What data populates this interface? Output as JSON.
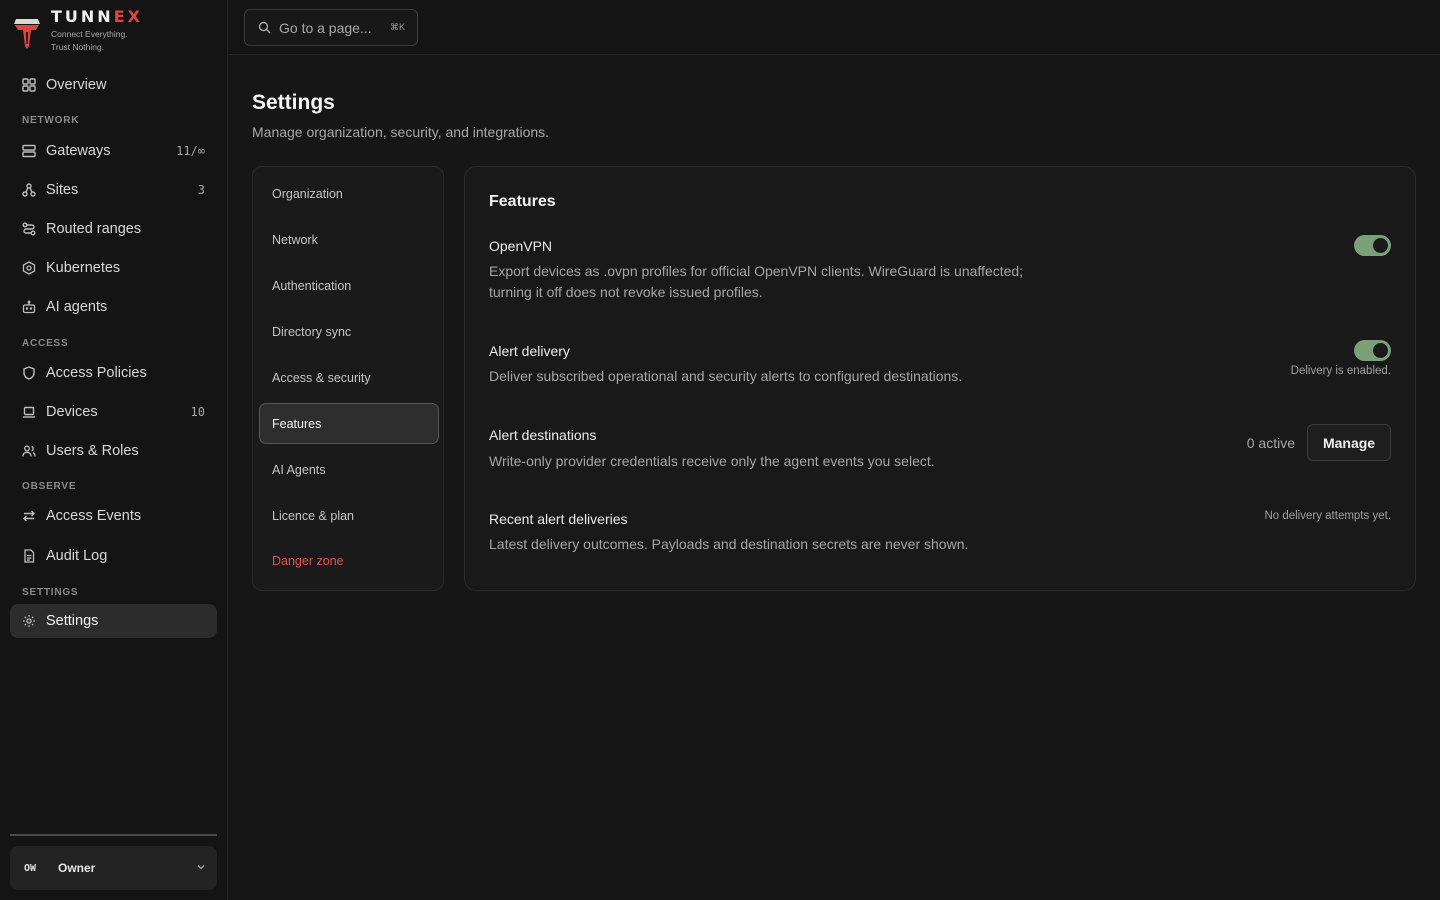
{
  "brand": {
    "name_main": "TUNN",
    "name_accent": "EX",
    "tagline_1": "Connect Everything.",
    "tagline_2": "Trust Nothing."
  },
  "sidebar": {
    "overview": {
      "label": "Overview",
      "icon": "grid-icon"
    },
    "sections": {
      "network": "NETWORK",
      "access": "ACCESS",
      "observe": "OBSERVE",
      "settings": "SETTINGS"
    },
    "items": {
      "gateways": {
        "label": "Gateways",
        "count": "11/∞",
        "icon": "server-icon"
      },
      "sites": {
        "label": "Sites",
        "count": "3",
        "icon": "sites-icon"
      },
      "routed_ranges": {
        "label": "Routed ranges",
        "icon": "route-icon"
      },
      "kubernetes": {
        "label": "Kubernetes",
        "icon": "kubernetes-icon"
      },
      "ai_agents": {
        "label": "AI agents",
        "icon": "bot-icon"
      },
      "access_policies": {
        "label": "Access Policies",
        "icon": "shield-icon"
      },
      "devices": {
        "label": "Devices",
        "count": "10",
        "icon": "laptop-icon"
      },
      "users_roles": {
        "label": "Users & Roles",
        "icon": "users-icon"
      },
      "access_events": {
        "label": "Access Events",
        "icon": "arrows-icon"
      },
      "audit_log": {
        "label": "Audit Log",
        "icon": "document-icon"
      },
      "settings": {
        "label": "Settings",
        "icon": "gear-icon"
      }
    },
    "owner": {
      "initials": "OW",
      "name": "Owner"
    }
  },
  "topbar": {
    "search_placeholder": "Go to a page...",
    "search_shortcut": "⌘K"
  },
  "page": {
    "title": "Settings",
    "subtitle": "Manage organization, security, and integrations."
  },
  "settings_nav": {
    "organization": "Organization",
    "network": "Network",
    "authentication": "Authentication",
    "directory_sync": "Directory sync",
    "access_security": "Access & security",
    "features": "Features",
    "ai_agents": "AI Agents",
    "licence_plan": "Licence & plan",
    "danger_zone": "Danger zone"
  },
  "features": {
    "title": "Features",
    "openvpn": {
      "title": "OpenVPN",
      "desc_1": "Export devices as .ovpn profiles for official OpenVPN clients. WireGuard is unaffected;",
      "desc_2": "turning it off does not revoke issued profiles.",
      "enabled": true
    },
    "alert_delivery": {
      "title": "Alert delivery",
      "desc": "Deliver subscribed operational and security alerts to configured destinations.",
      "enabled": true,
      "status": "Delivery is enabled."
    },
    "alert_destinations": {
      "title": "Alert destinations",
      "desc": "Write-only provider credentials receive only the agent events you select.",
      "active_count": "0 active",
      "manage_label": "Manage"
    },
    "recent_deliveries": {
      "title": "Recent alert deliveries",
      "desc": "Latest delivery outcomes. Payloads and destination secrets are never shown.",
      "status": "No delivery attempts yet."
    }
  },
  "colors": {
    "accent_red": "#e0453f",
    "toggle_on": "#7aa07a",
    "danger": "#e0544e"
  }
}
